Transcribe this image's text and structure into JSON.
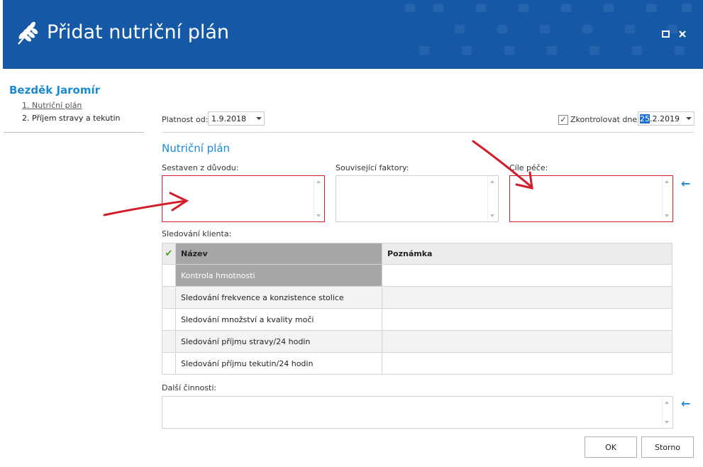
{
  "window": {
    "title": "Přidat nutriční plán",
    "logo_icon": "wheat-icon",
    "controls": [
      "maximize-icon",
      "close-icon"
    ],
    "brand_color": "#1559a6"
  },
  "sidebar": {
    "client_name": "Bezděk Jaromír",
    "items": [
      {
        "label": "1. Nutriční plán"
      },
      {
        "label": "2. Příjem stravy a tekutin"
      }
    ]
  },
  "header": {
    "valid_from_label": "Platnost od:",
    "valid_from_value": "1.9.2018",
    "check_label": "Zkontrolovat dne:",
    "check_checked": true,
    "check_day": "25",
    "check_rest": ".2.2019"
  },
  "plan": {
    "section_title": "Nutriční plán",
    "reason_label": "Sestaven z důvodu:",
    "factors_label": "Související faktory:",
    "goals_label": "Cíle péče:"
  },
  "tracking": {
    "label": "Sledování klienta:",
    "columns": [
      "Název",
      "Poznámka"
    ],
    "rows": [
      {
        "name": "Kontrola hmotnosti",
        "note": ""
      },
      {
        "name": "Sledování frekvence a konzistence stolice",
        "note": ""
      },
      {
        "name": "Sledování množství a kvality moči",
        "note": ""
      },
      {
        "name": "Sledování příjmu stravy/24 hodin",
        "note": ""
      },
      {
        "name": "Sledování příjmu tekutin/24 hodin",
        "note": ""
      }
    ]
  },
  "other": {
    "label": "Další činnosti:"
  },
  "buttons": {
    "ok": "OK",
    "cancel": "Storno"
  },
  "colors": {
    "accent": "#1a8ad4",
    "annotation_red": "#d11e2a"
  }
}
